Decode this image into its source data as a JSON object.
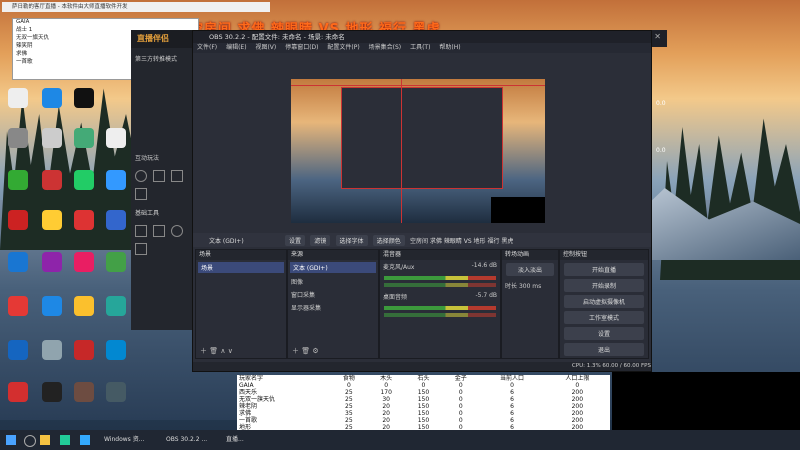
{
  "overlay": {
    "stream_title": "空房间 求佛 辣眼睛 VS 地形 福行 黑虎"
  },
  "top_small_window": {
    "title": "萨日勒的客厅直播 - 本软件由大师直播软件开发"
  },
  "left_panel": {
    "rows": [
      "GAIA",
      "战士 1",
      "无双一旗天仇",
      "辣笑阴",
      "求佛",
      "一首歌"
    ]
  },
  "zhibo": {
    "header": "直播伴侣",
    "mode_label": "第三方转推模式",
    "section_interact": "互动玩法",
    "section_tools": "基础工具"
  },
  "obs": {
    "title": "OBS 30.2.2 - 配置文件: 未命名 - 场景: 未命名",
    "menu": [
      "文件(F)",
      "编辑(E)",
      "视图(V)",
      "停靠窗口(D)",
      "配置文件(P)",
      "场景集合(S)",
      "工具(T)",
      "帮助(H)"
    ],
    "source_bar": {
      "label": "文本 (GDI+)",
      "buttons": [
        "设置",
        "滤镜",
        "选择字体",
        "选择颜色"
      ],
      "text": "空房间 求佛 辣眼睛 VS 地形 福行 黑虎"
    },
    "scenes": {
      "header": "场景",
      "items": [
        "场景"
      ]
    },
    "sources": {
      "header": "来源",
      "items": [
        "文本 (GDI+)",
        "图像",
        "窗口采集",
        "显示器采集"
      ]
    },
    "mixer": {
      "header": "混音器",
      "channels": [
        {
          "name": "麦克风/Aux",
          "db": "-14.6 dB"
        },
        {
          "name": "桌面音频",
          "db": "-5.7 dB"
        }
      ]
    },
    "transitions": {
      "header": "转场动画",
      "type": "淡入淡出",
      "duration_label": "时长",
      "duration": "300 ms"
    },
    "controls": {
      "header": "控制按钮",
      "buttons": [
        "开始直播",
        "开始录制",
        "启动虚拟摄像机",
        "工作室模式",
        "设置",
        "退出"
      ]
    },
    "status": "CPU: 1.3%   60.00 / 60.00 FPS"
  },
  "score_table": {
    "headers": [
      "玩家名字",
      "食物",
      "木头",
      "石头",
      "金子",
      "当前人口",
      "人口上限"
    ],
    "rows": [
      [
        "GAIA",
        "0",
        "0",
        "0",
        "0",
        "0",
        "0"
      ],
      [
        "西天乐",
        "25",
        "170",
        "150",
        "0",
        "6",
        "200"
      ],
      [
        "无双一旗天仇",
        "25",
        "30",
        "150",
        "0",
        "6",
        "200"
      ],
      [
        "辣老阴",
        "25",
        "20",
        "150",
        "0",
        "6",
        "200"
      ],
      [
        "求佛",
        "35",
        "20",
        "150",
        "0",
        "6",
        "200"
      ],
      [
        "一首歌",
        "25",
        "20",
        "150",
        "0",
        "6",
        "200"
      ],
      [
        "地形",
        "25",
        "20",
        "150",
        "0",
        "6",
        "200"
      ]
    ]
  },
  "taskbar": {
    "items": [
      "Windows 资...",
      "OBS 30.2.2 ...",
      "直播..."
    ]
  }
}
